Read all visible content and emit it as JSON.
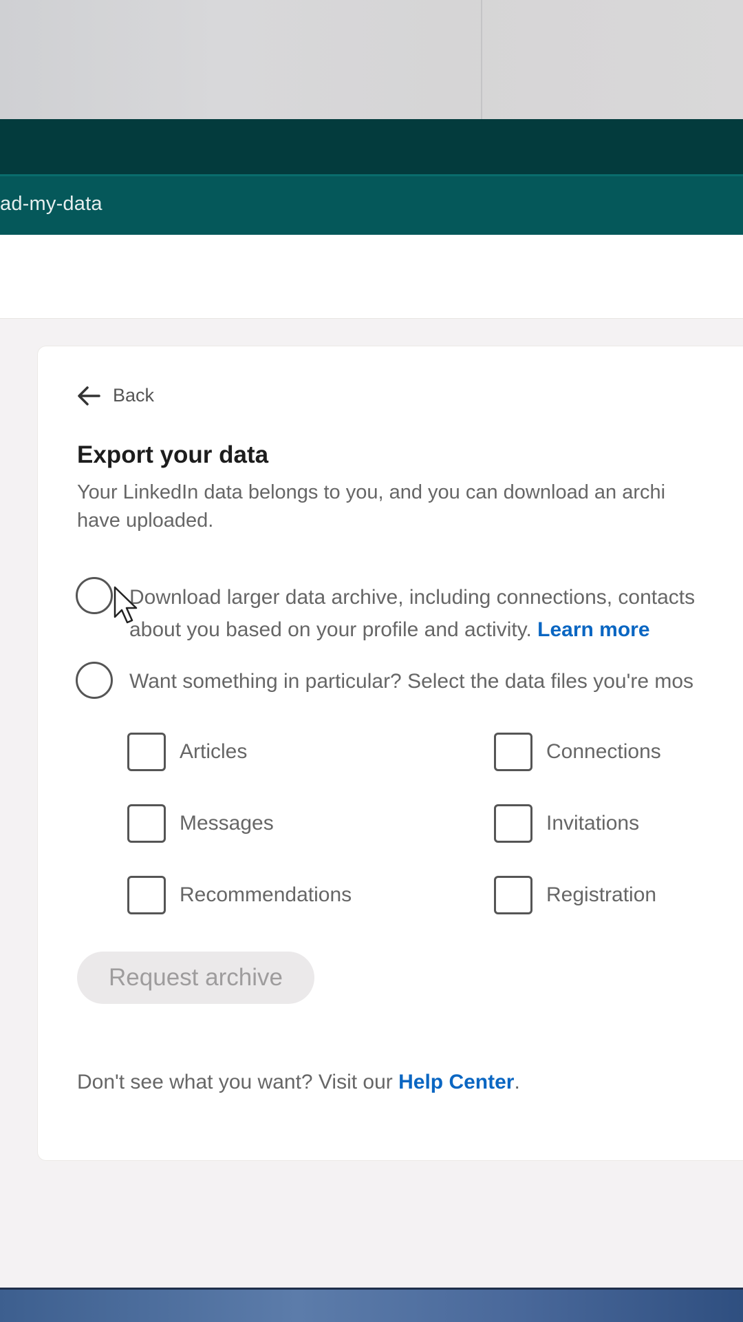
{
  "browser": {
    "address_fragment": "ad-my-data"
  },
  "back": {
    "label": "Back"
  },
  "export": {
    "title": "Export your data",
    "description_line1": "Your LinkedIn data belongs to you, and you can download an archi",
    "description_line2": "have uploaded.",
    "option_full": {
      "line1": "Download larger data archive, including connections, contacts",
      "line2": "about you based on your profile and activity.",
      "learn_more": "Learn more"
    },
    "option_particular": {
      "text": "Want something in particular? Select the data files you're mos"
    },
    "checkboxes": [
      "Articles",
      "Connections",
      "Messages",
      "Invitations",
      "Recommendations",
      "Registration"
    ],
    "request_button": "Request archive",
    "help": {
      "prefix": "Don't see what you want? Visit our ",
      "link": "Help Center",
      "suffix": "."
    }
  },
  "colors": {
    "accent_link": "#0a66c2",
    "browser_titlebar": "#033b3d",
    "browser_addressbar": "#05585a"
  },
  "icons": [
    "back-arrow-icon",
    "mouse-pointer-icon"
  ]
}
